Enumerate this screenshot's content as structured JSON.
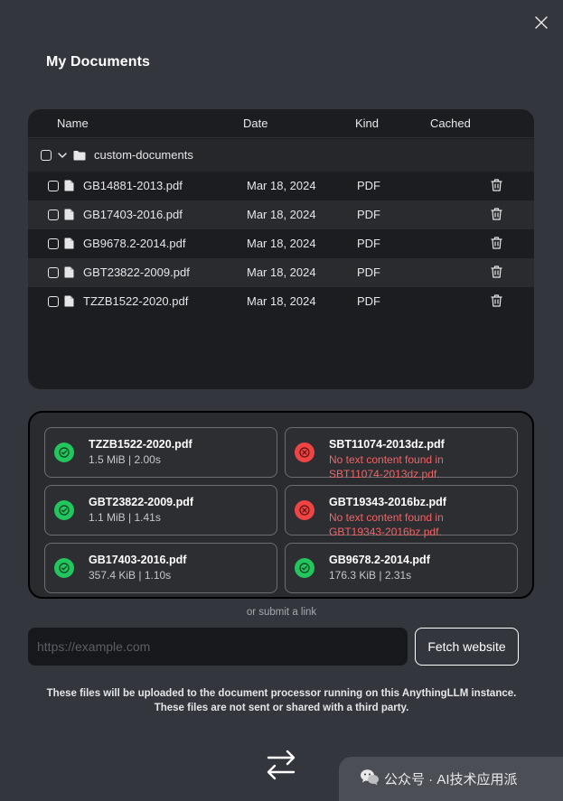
{
  "title": "My Documents",
  "table": {
    "headers": {
      "name": "Name",
      "date": "Date",
      "kind": "Kind",
      "cached": "Cached"
    },
    "folder": {
      "name": "custom-documents"
    },
    "files": [
      {
        "name": "GB14881-2013.pdf",
        "date": "Mar 18, 2024",
        "kind": "PDF"
      },
      {
        "name": "GB17403-2016.pdf",
        "date": "Mar 18, 2024",
        "kind": "PDF"
      },
      {
        "name": "GB9678.2-2014.pdf",
        "date": "Mar 18, 2024",
        "kind": "PDF"
      },
      {
        "name": "GBT23822-2009.pdf",
        "date": "Mar 18, 2024",
        "kind": "PDF"
      },
      {
        "name": "TZZB1522-2020.pdf",
        "date": "Mar 18, 2024",
        "kind": "PDF"
      }
    ]
  },
  "uploads": [
    {
      "name": "TZZB1522-2020.pdf",
      "meta": "1.5 MiB | 2.00s",
      "status": "success"
    },
    {
      "name": "SBT11074-2013dz.pdf",
      "error_line1": "No text content found in",
      "error_line2": "SBT11074-2013dz.pdf.",
      "status": "error"
    },
    {
      "name": "GBT23822-2009.pdf",
      "meta": "1.1 MiB | 1.41s",
      "status": "success"
    },
    {
      "name": "GBT19343-2016bz.pdf",
      "error_line1": "No text content found in",
      "error_line2": "GBT19343-2016bz.pdf.",
      "status": "error"
    },
    {
      "name": "GB17403-2016.pdf",
      "meta": "357.4 KiB | 1.10s",
      "status": "success"
    },
    {
      "name": "GB9678.2-2014.pdf",
      "meta": "176.3 KiB | 2.31s",
      "status": "success"
    }
  ],
  "link": {
    "or_label": "or submit a link",
    "placeholder": "https://example.com",
    "value": "",
    "fetch_label": "Fetch website"
  },
  "notice": {
    "line1": "These files will be uploaded to the document processor running on this AnythingLLM instance.",
    "line2": "These files are not sent or shared with a third party."
  },
  "watermark": {
    "text": "公众号 · AI技术应用派"
  },
  "colors": {
    "background": "#33363d",
    "panel": "#1c1d21",
    "success": "#22c55e",
    "error": "#ef4444",
    "error_text": "#f16464"
  }
}
